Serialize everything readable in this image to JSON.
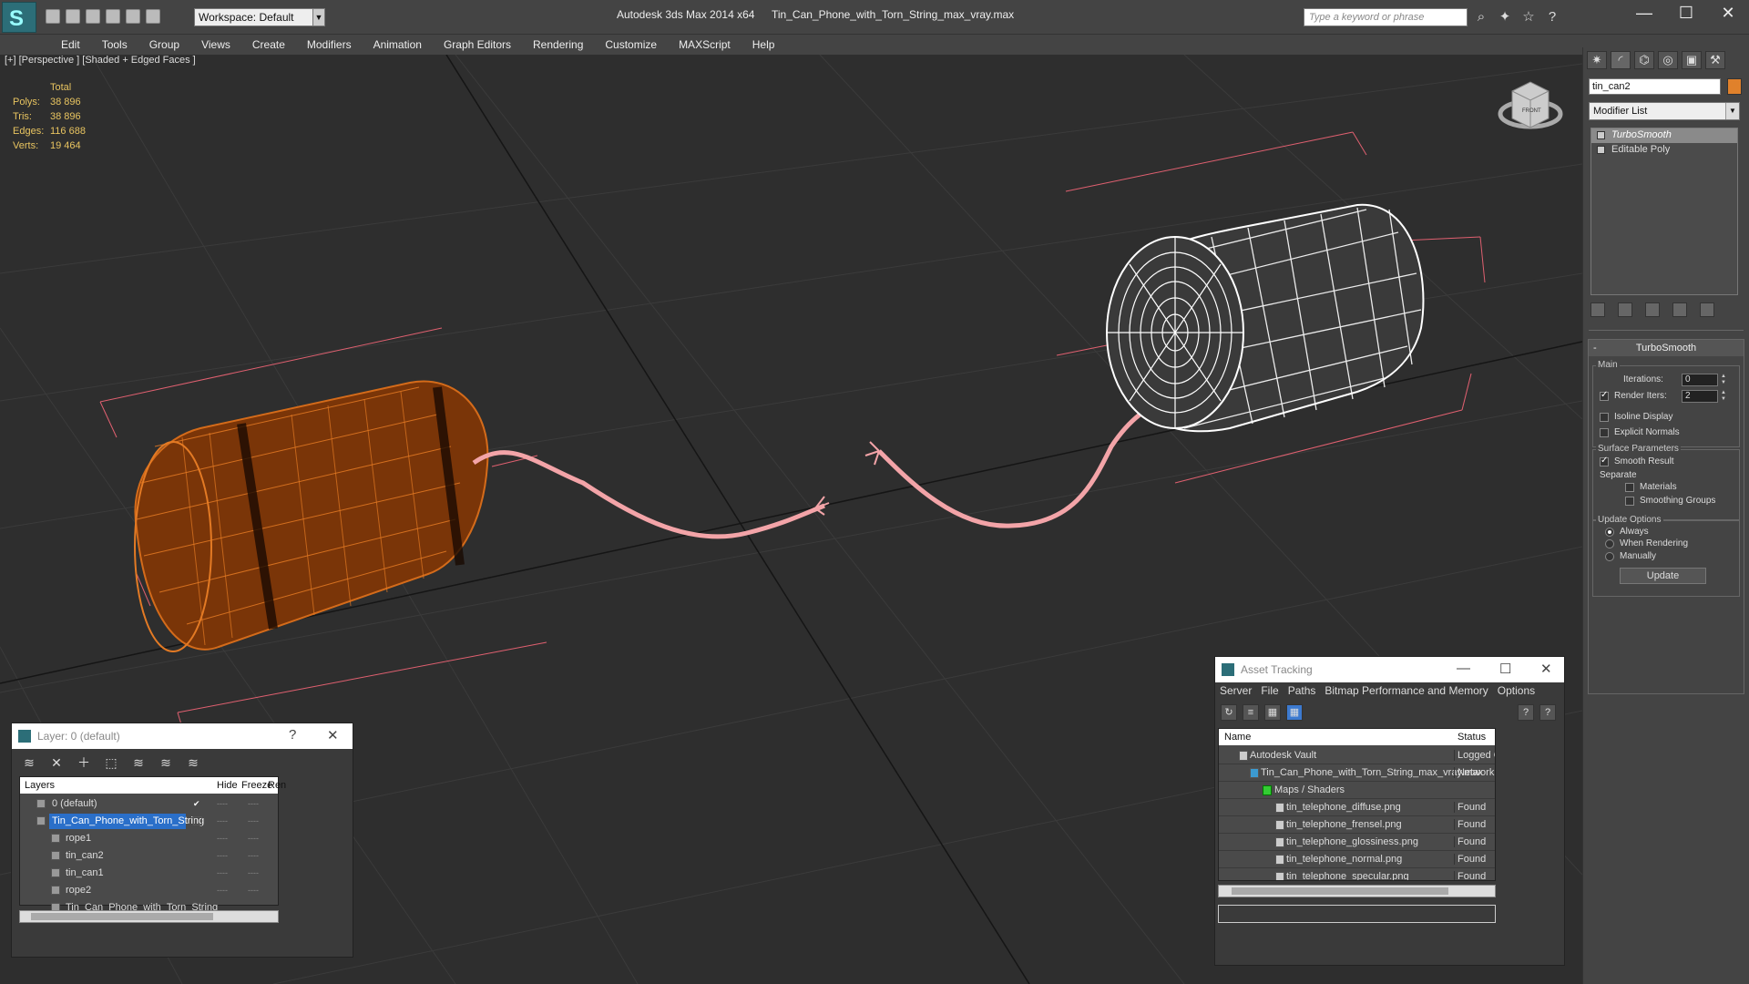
{
  "titlebar": {
    "logo_glyph": "S",
    "workspace": "Workspace: Default",
    "app_title": "Autodesk 3ds Max  2014 x64",
    "doc_title": "Tin_Can_Phone_with_Torn_String_max_vray.max",
    "search_placeholder": "Type a keyword or phrase"
  },
  "menu": [
    "Edit",
    "Tools",
    "Group",
    "Views",
    "Create",
    "Modifiers",
    "Animation",
    "Graph Editors",
    "Rendering",
    "Customize",
    "MAXScript",
    "Help"
  ],
  "viewport": {
    "label": "[+] [Perspective ] [Shaded + Edged Faces ]",
    "stats_header": "Total",
    "stats": [
      {
        "k": "Polys:",
        "v": "38 896"
      },
      {
        "k": "Tris:",
        "v": "38 896"
      },
      {
        "k": "Edges:",
        "v": "116 688"
      },
      {
        "k": "Verts:",
        "v": "19 464"
      }
    ],
    "viewcube_label": "FRONT"
  },
  "command_panel": {
    "object_name": "tin_can2",
    "object_color": "#e0812b",
    "modifier_list": "Modifier List",
    "stack": [
      "TurboSmooth",
      "Editable Poly"
    ],
    "rollout_title": "TurboSmooth",
    "main_group": "Main",
    "iterations_label": "Iterations:",
    "iterations_value": "0",
    "render_iters_label": "Render Iters:",
    "render_iters_value": "2",
    "isoline": "Isoline Display",
    "explicit_normals": "Explicit Normals",
    "surface_group": "Surface Parameters",
    "smooth_result": "Smooth Result",
    "separate": "Separate",
    "materials": "Materials",
    "smoothing_groups": "Smoothing Groups",
    "update_group": "Update Options",
    "always": "Always",
    "when_rendering": "When Rendering",
    "manually": "Manually",
    "update_btn": "Update"
  },
  "layer_dialog": {
    "title": "Layer: 0 (default)",
    "help": "?",
    "close": "✕",
    "col_layers": "Layers",
    "col_hide": "Hide",
    "col_freeze": "Freeze",
    "col_render": "Ren",
    "rows": [
      {
        "name": "0 (default)",
        "indent": 0
      },
      {
        "name": "Tin_Can_Phone_with_Torn_String",
        "indent": 0
      },
      {
        "name": "rope1",
        "indent": 1
      },
      {
        "name": "tin_can2",
        "indent": 1
      },
      {
        "name": "tin_can1",
        "indent": 1
      },
      {
        "name": "rope2",
        "indent": 1
      },
      {
        "name": "Tin_Can_Phone_with_Torn_String",
        "indent": 1
      }
    ]
  },
  "asset_dialog": {
    "title": "Asset Tracking",
    "menu": [
      "Server",
      "File",
      "Paths",
      "Bitmap Performance and Memory",
      "Options"
    ],
    "col_name": "Name",
    "col_status": "Status",
    "rows": [
      {
        "name": "Autodesk Vault",
        "status": "Logged Ou",
        "indent": 1
      },
      {
        "name": "Tin_Can_Phone_with_Torn_String_max_vray.max",
        "status": "Network Pa",
        "indent": 2
      },
      {
        "name": "Maps / Shaders",
        "status": "",
        "indent": 3
      },
      {
        "name": "tin_telephone_diffuse.png",
        "status": "Found",
        "indent": 4
      },
      {
        "name": "tin_telephone_frensel.png",
        "status": "Found",
        "indent": 4
      },
      {
        "name": "tin_telephone_glossiness.png",
        "status": "Found",
        "indent": 4
      },
      {
        "name": "tin_telephone_normal.png",
        "status": "Found",
        "indent": 4
      },
      {
        "name": "tin_telephone_specular.png",
        "status": "Found",
        "indent": 4
      }
    ]
  }
}
